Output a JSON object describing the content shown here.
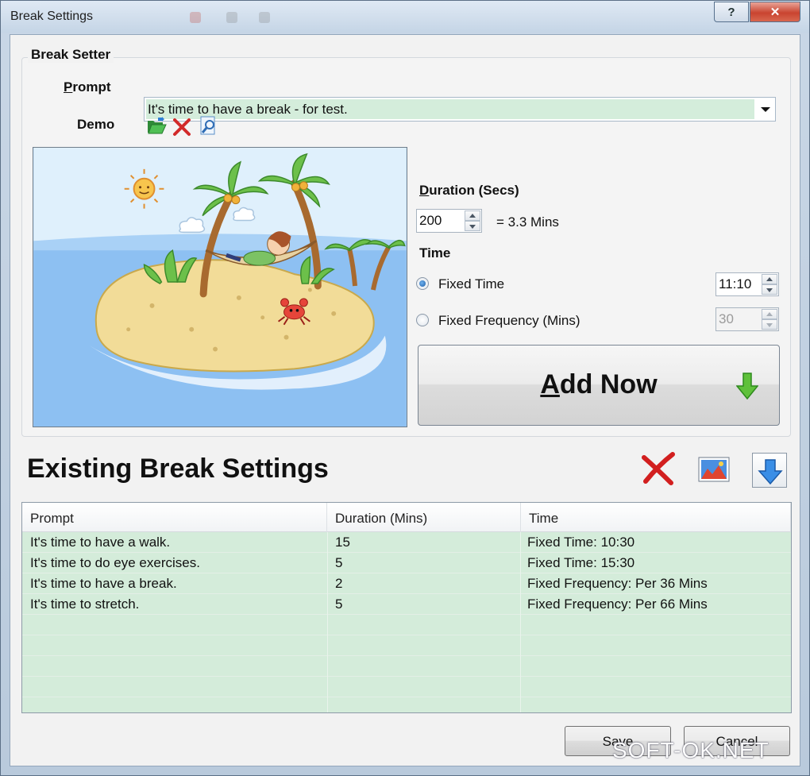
{
  "window": {
    "title": "Break Settings",
    "help_glyph": "?",
    "close_glyph": "✕"
  },
  "break_setter": {
    "legend": "Break Setter",
    "prompt_label": "Prompt",
    "prompt_value": "It's time to have a break - for test.",
    "demo_label": "Demo",
    "demo_icons": [
      "folder-open-icon",
      "delete-x-icon",
      "preview-magnify-icon"
    ],
    "duration_label": "Duration (Secs)",
    "duration_value": "200",
    "duration_conversion": "= 3.3 Mins",
    "time_label": "Time",
    "fixed_time_label": "Fixed Time",
    "fixed_time_value": "11:10",
    "fixed_time_checked": true,
    "fixed_frequency_label": "Fixed Frequency (Mins)",
    "fixed_frequency_value": "30",
    "fixed_frequency_checked": false,
    "add_now_label": "Add Now"
  },
  "existing": {
    "title": "Existing Break Settings",
    "toolbar_icons": [
      "delete-red-x-icon",
      "image-icon",
      "download-arrow-icon"
    ],
    "columns": [
      "Prompt",
      "Duration (Mins)",
      "Time"
    ],
    "rows": [
      [
        "It's time to have a walk.",
        "15",
        "Fixed Time: 10:30"
      ],
      [
        "It's time to do eye exercises.",
        "5",
        "Fixed Time: 15:30"
      ],
      [
        "It's time to have a break.",
        "2",
        "Fixed Frequency: Per 36 Mins"
      ],
      [
        "It's time to stretch.",
        "5",
        "Fixed Frequency: Per 66 Mins"
      ]
    ]
  },
  "footer": {
    "save_label": "Save",
    "cancel_label": "Cancel"
  },
  "watermark": "SOFT-OK.NET",
  "colors": {
    "selection_green": "#d4ecda",
    "sky": "#9ac7f4",
    "sea": "#8dc0f2",
    "sand": "#f2dc98"
  }
}
